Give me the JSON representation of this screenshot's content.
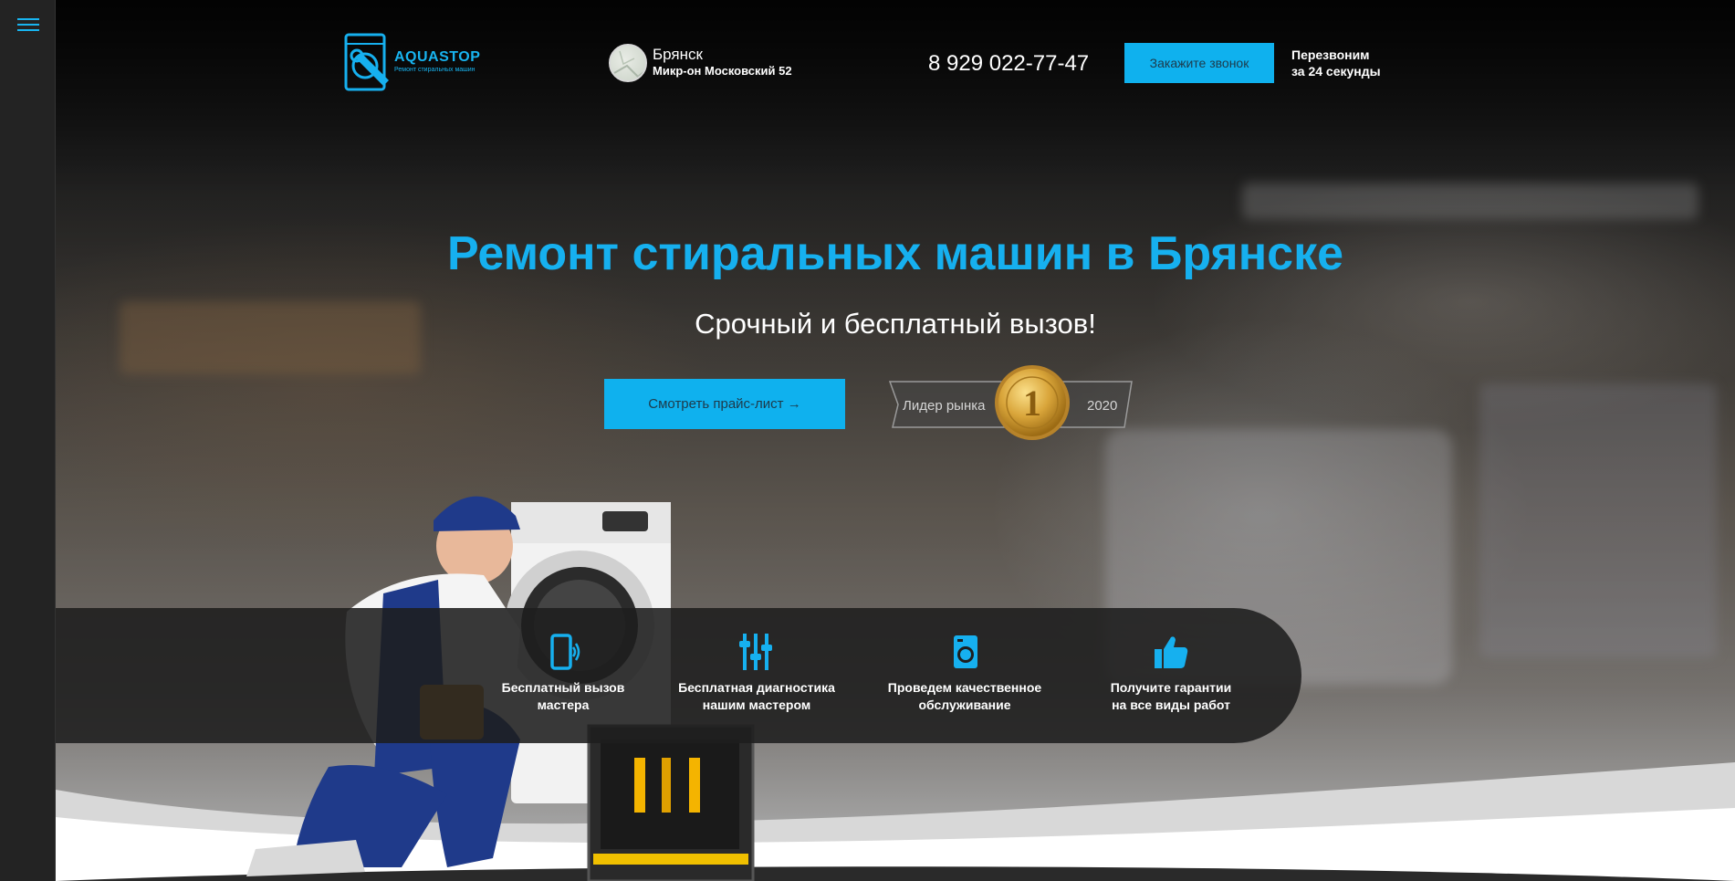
{
  "brand": {
    "name": "AQUASTOP",
    "tagline": "Ремонт стиральных машин"
  },
  "location": {
    "city": "Брянск",
    "address": "Микр-он  Московский 52"
  },
  "contact": {
    "phone": "8 929 022-77-47",
    "callback_button": "Закажите звонок",
    "callback_note_line1": "Перезвоним",
    "callback_note_line2": "за 24 секунды"
  },
  "hero": {
    "title": "Ремонт стиральных машин в Брянске",
    "subtitle": "Срочный и бесплатный вызов!",
    "price_button": "Смотреть прайс-лист →",
    "badge": {
      "label": "Лидер рынка",
      "rank": "1",
      "year": "2020"
    }
  },
  "features": [
    {
      "icon": "phone-icon",
      "line1": "Бесплатный вызов",
      "line2": "мастера"
    },
    {
      "icon": "diagnostics-icon",
      "line1": "Бесплатная диагностика",
      "line2": "нашим мастером"
    },
    {
      "icon": "washing-machine-icon",
      "line1": "Проведем качественное",
      "line2": "обслуживание"
    },
    {
      "icon": "thumbs-up-icon",
      "line1": "Получите гарантии",
      "line2": "на все виды работ"
    }
  ],
  "colors": {
    "accent": "#0fb1ee",
    "title": "#16b0ef",
    "button_text": "#1e3a4a",
    "features_bg": "#1e1e1e"
  }
}
